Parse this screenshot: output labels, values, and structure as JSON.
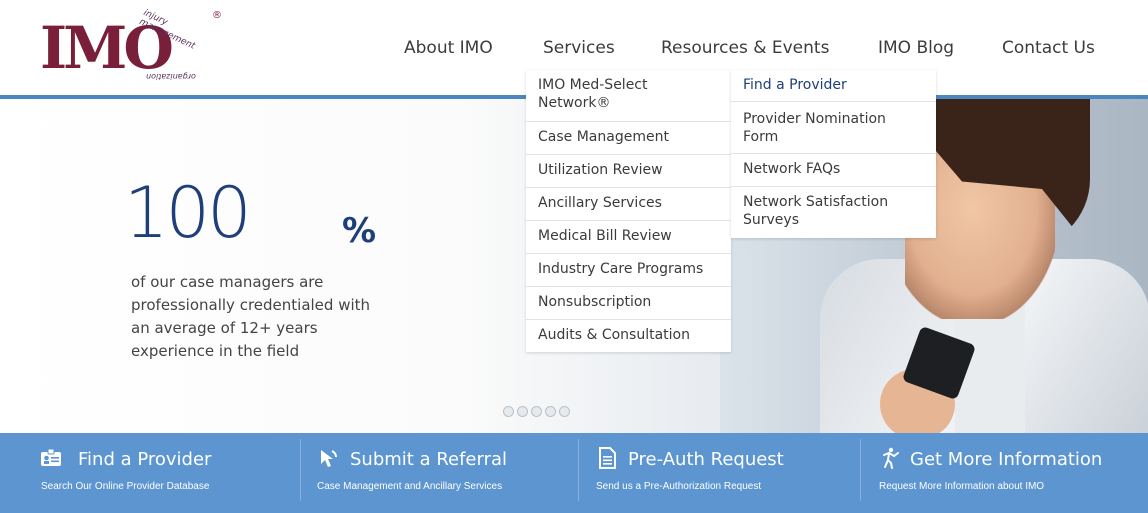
{
  "logo": {
    "letters": "IMO",
    "arc_top": "injury management",
    "arc_bottom": "organization",
    "reg": "®"
  },
  "nav": {
    "items": [
      "About IMO",
      "Services",
      "Resources & Events",
      "IMO Blog",
      "Contact Us"
    ]
  },
  "hero": {
    "stat_number": "100",
    "stat_suffix": "%",
    "stat_lines": [
      "of our case managers are",
      "professionally credentialed with",
      "an average of 12+ years",
      "experience in the field"
    ],
    "slides_count": 5
  },
  "services_menu": {
    "items": [
      "IMO Med-Select Network®",
      "Case Management",
      "Utilization Review",
      "Ancillary Services",
      "Medical Bill Review",
      "Industry Care Programs",
      "Nonsubscription",
      "Audits & Consultation"
    ]
  },
  "network_submenu": {
    "items": [
      "Find a Provider",
      "Provider Nomination Form",
      "Network FAQs",
      "Network Satisfaction Surveys"
    ],
    "active": "Find a Provider"
  },
  "cta": [
    {
      "title": "Find a Provider",
      "subtitle": "Search Our Online Provider Database",
      "icon": "id-card-icon"
    },
    {
      "title": "Submit a Referral",
      "subtitle": "Case Management and Ancillary Services",
      "icon": "mouse-cursor-icon"
    },
    {
      "title": "Pre-Auth Request",
      "subtitle": "Send us a Pre-Authorization Request",
      "icon": "document-icon"
    },
    {
      "title": "Get More Information",
      "subtitle": "Request More Information about IMO",
      "icon": "running-person-icon"
    }
  ],
  "colors": {
    "brand_maroon": "#7a1f3a",
    "accent_blue": "#4a86c0",
    "cta_bar": "#5c95cf",
    "stat_blue": "#1f3f7a"
  }
}
